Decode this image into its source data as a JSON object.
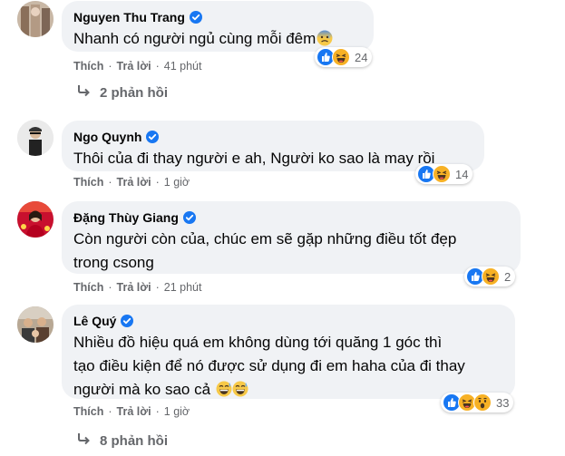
{
  "comments": [
    {
      "name": "Nguyen Thu Trang",
      "text": "Nhanh có người ngủ cùng mỗi đêm",
      "trailing_emoji": "anxious-face",
      "like_label": "Thích",
      "reply_label": "Trả lời",
      "separator": "·",
      "time": "41 phút",
      "reactions": [
        "like",
        "haha"
      ],
      "reaction_count": "24",
      "replies": "2 phản hồi"
    },
    {
      "name": "Ngo Quynh",
      "text": "Thôi của đi thay người e ah, Người ko sao là may rồi",
      "like_label": "Thích",
      "reply_label": "Trả lời",
      "separator": "·",
      "time": "1 giờ",
      "reactions": [
        "like",
        "haha"
      ],
      "reaction_count": "14"
    },
    {
      "name": "Đặng Thùy Giang",
      "text_line1": "Còn người còn của, chúc em sẽ gặp những điều tốt đẹp",
      "text_line2": "trong csong",
      "like_label": "Thích",
      "reply_label": "Trả lời",
      "separator": "·",
      "time": "21 phút",
      "reactions": [
        "like",
        "haha"
      ],
      "reaction_count": "2"
    },
    {
      "name": "Lê Quý",
      "text_line1": "Nhiều đồ hiệu quá em không dùng tới quăng 1 góc thì",
      "text_line2": "tạo điều kiện để nó được sử dụng đi em haha của đi thay",
      "text_line3": "người mà ko sao cả",
      "trailing_emoji": "grinning-sweat-face",
      "like_label": "Thích",
      "reply_label": "Trả lời",
      "separator": "·",
      "time": "1 giờ",
      "reactions": [
        "like",
        "haha",
        "wow"
      ],
      "reaction_count": "33",
      "replies": "8 phản hồi"
    }
  ],
  "colors": {
    "bubble": "#f0f2f5",
    "verified": "#1877f2",
    "secondary_text": "#65676b",
    "like": "#1877f2",
    "haha": "#f7b125"
  }
}
